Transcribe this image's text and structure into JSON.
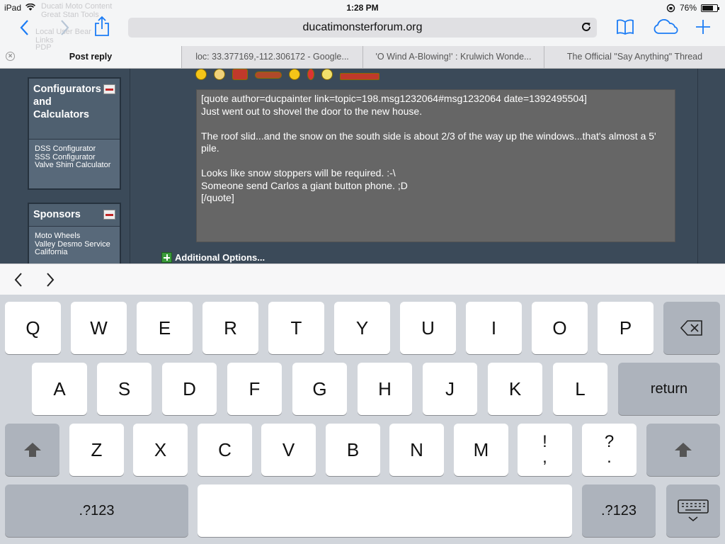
{
  "status_bar": {
    "device": "iPad",
    "time": "1:28 PM",
    "battery": "76%",
    "battery_level": 0.76
  },
  "toolbar": {
    "url": "ducatimonsterforum.org",
    "back_icon": "chevron-left-icon",
    "forward_icon": "chevron-right-icon",
    "share_icon": "share-icon",
    "reload_icon": "reload-icon",
    "bookmarks_icon": "book-icon",
    "cloud_icon": "cloud-icon",
    "new_tab_icon": "plus-icon"
  },
  "ghost_text": {
    "line1": "Ducati Moto Content",
    "line2": "Great Stan Tools",
    "line3": "Local User Bear",
    "line4": "Links",
    "line5": "PDP"
  },
  "tabs": [
    {
      "label": "Post reply",
      "active": true
    },
    {
      "label": "loc: 33.377169,-112.306172 - Google..."
    },
    {
      "label": "'O Wind A-Blowing!' : Krulwich Wonde..."
    },
    {
      "label": "The Official \"Say Anything\" Thread"
    }
  ],
  "sidebar": {
    "configurators": {
      "title": "Configurators and Calculators",
      "links": [
        "DSS Configurator",
        "SSS Configurator",
        "Valve Shim Calculator"
      ]
    },
    "sponsors": {
      "title": "Sponsors",
      "links": [
        "Moto Wheels",
        "Valley Desmo Service",
        "California"
      ]
    }
  },
  "post": {
    "textarea_value": "[quote author=ducpainter link=topic=198.msg1232064#msg1232064 date=1392495504]\nJust went out to shovel the door to the new house.\n\nThe roof slid...and the snow on the south side is about 2/3 of the way up the windows...that's almost a 5' pile.\n\nLooks like snow stoppers will be required. :-\\\nSomeone send Carlos a giant button phone. ;D\n[/quote]",
    "additional_options": "Additional Options..."
  },
  "keyboard": {
    "row1": [
      "Q",
      "W",
      "E",
      "R",
      "T",
      "Y",
      "U",
      "I",
      "O",
      "P"
    ],
    "row2": [
      "A",
      "S",
      "D",
      "F",
      "G",
      "H",
      "J",
      "K",
      "L"
    ],
    "row3": [
      "Z",
      "X",
      "C",
      "V",
      "B",
      "N",
      "M"
    ],
    "punct1": {
      "top": "!",
      "bottom": ","
    },
    "punct2": {
      "top": "?",
      "bottom": "."
    },
    "return": "return",
    "numbers": ".?123",
    "backspace_icon": "backspace-icon",
    "shift_icon": "shift-icon",
    "dismiss_icon": "keyboard-dismiss-icon"
  }
}
